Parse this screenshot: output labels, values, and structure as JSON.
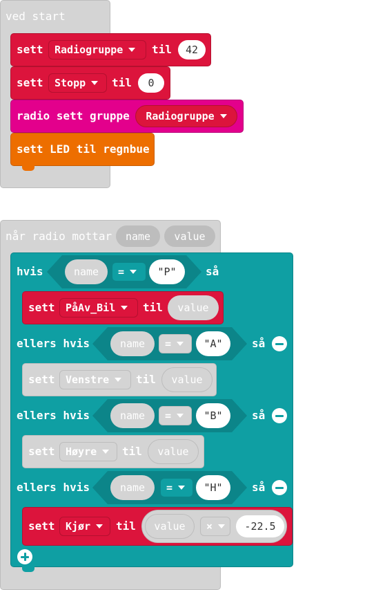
{
  "on_start": {
    "header": "ved start",
    "block1": {
      "keyword": "sett",
      "variable": "Radiogruppe",
      "to": "til",
      "value": "42"
    },
    "block2": {
      "keyword": "sett",
      "variable": "Stopp",
      "to": "til",
      "value": "0"
    },
    "block3": {
      "label": "radio sett gruppe",
      "variable": "Radiogruppe"
    },
    "block4": {
      "label": "sett LED til regnbue"
    }
  },
  "on_radio": {
    "header": "når radio mottar",
    "param1": "name",
    "param2": "value",
    "if": {
      "keyword": "hvis",
      "lhs": "name",
      "op": "=",
      "rhs": "\"P\"",
      "then": "så"
    },
    "set1": {
      "keyword": "sett",
      "variable": "PåAv_Bil",
      "to": "til",
      "value": "value"
    },
    "elif1": {
      "keyword": "ellers hvis",
      "lhs": "name",
      "op": "=",
      "rhs": "\"A\"",
      "then": "så"
    },
    "set2": {
      "keyword": "sett",
      "variable": "Venstre",
      "to": "til",
      "value": "value"
    },
    "elif2": {
      "keyword": "ellers hvis",
      "lhs": "name",
      "op": "=",
      "rhs": "\"B\"",
      "then": "så"
    },
    "set3": {
      "keyword": "sett",
      "variable": "Høyre",
      "to": "til",
      "value": "value"
    },
    "elif3": {
      "keyword": "ellers hvis",
      "lhs": "name",
      "op": "=",
      "rhs": "\"H\"",
      "then": "så"
    },
    "set4": {
      "keyword": "sett",
      "variable": "Kjør",
      "to": "til",
      "value": "value",
      "op": "×",
      "operand": "-22.5"
    }
  },
  "colors": {
    "variables": "#dc143c",
    "radio": "#e3008c",
    "led": "#ed6e00",
    "logic": "#0f9fa3",
    "disabled": "#d4d4d4",
    "event": "#d4d4d4"
  },
  "icons": [
    "minus-circle-icon",
    "plus-circle-icon",
    "dropdown-caret-icon"
  ]
}
